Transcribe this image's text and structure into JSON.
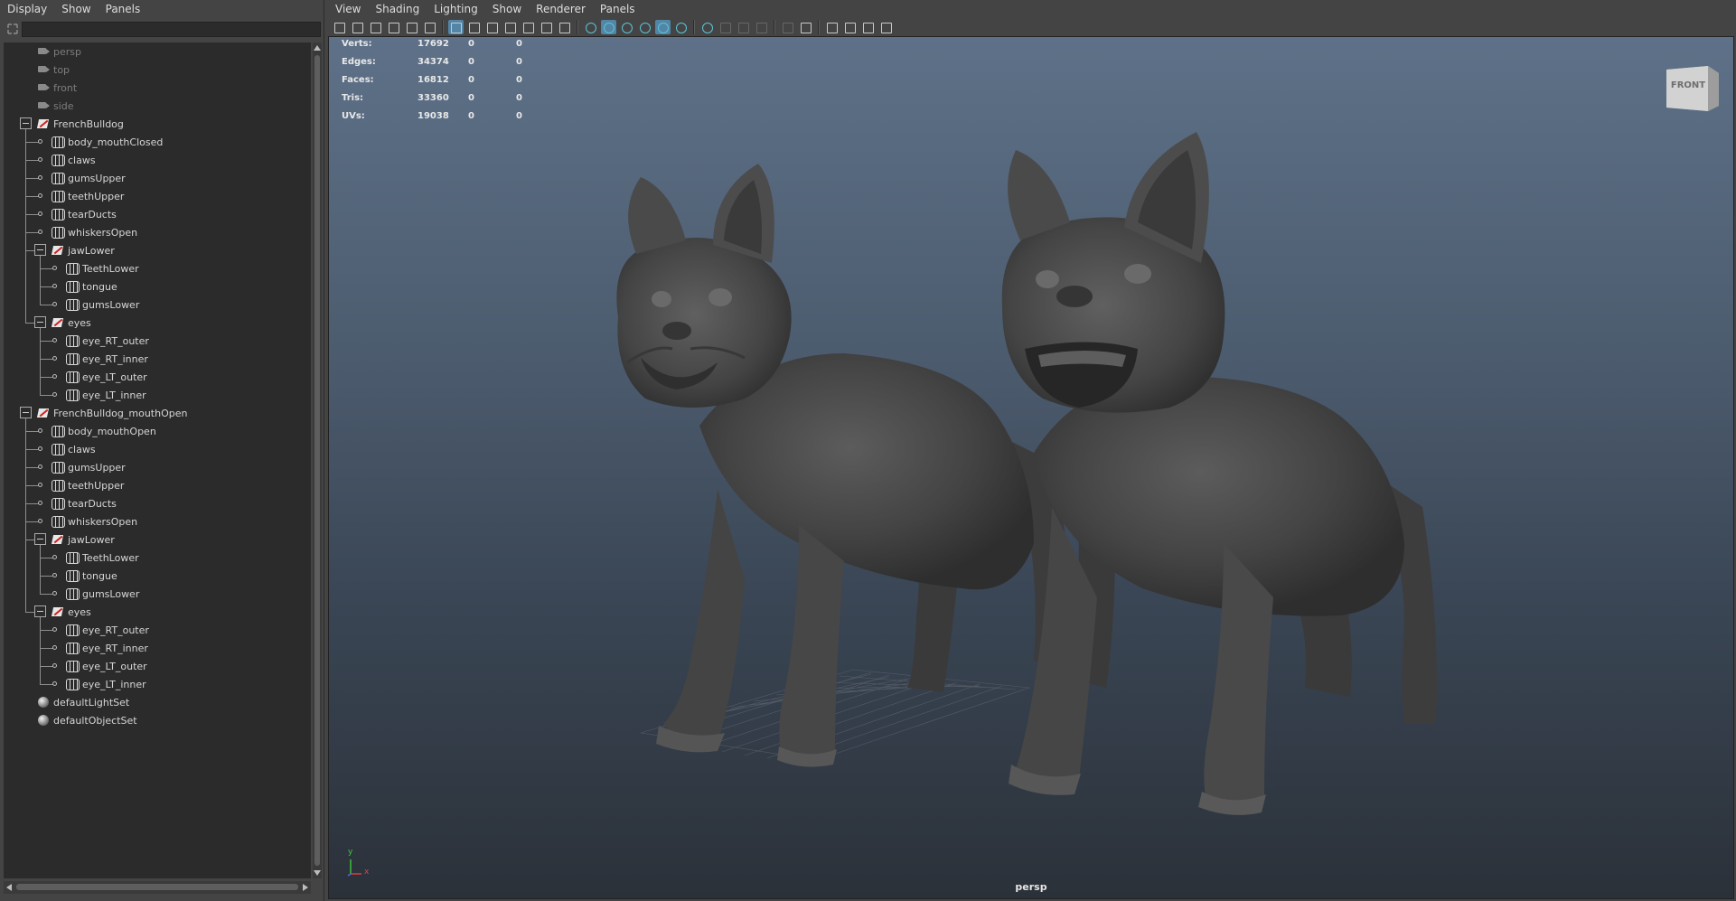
{
  "outliner": {
    "menu": [
      "Display",
      "Show",
      "Panels"
    ],
    "search_value": "",
    "nodes": [
      {
        "label": "persp",
        "icon": "camera-icon",
        "dim": true
      },
      {
        "label": "top",
        "icon": "camera-icon",
        "dim": true
      },
      {
        "label": "front",
        "icon": "camera-icon",
        "dim": true
      },
      {
        "label": "side",
        "icon": "camera-icon",
        "dim": true
      },
      {
        "label": "FrenchBulldog",
        "icon": "transform-icon",
        "expanded": true
      },
      {
        "label": "body_mouthClosed",
        "icon": "mesh-icon"
      },
      {
        "label": "claws",
        "icon": "mesh-icon"
      },
      {
        "label": "gumsUpper",
        "icon": "mesh-icon"
      },
      {
        "label": "teethUpper",
        "icon": "mesh-icon"
      },
      {
        "label": "tearDucts",
        "icon": "mesh-icon"
      },
      {
        "label": "whiskersOpen",
        "icon": "mesh-icon"
      },
      {
        "label": "jawLower",
        "icon": "transform-icon",
        "expanded": true
      },
      {
        "label": "TeethLower",
        "icon": "mesh-icon"
      },
      {
        "label": "tongue",
        "icon": "mesh-icon"
      },
      {
        "label": "gumsLower",
        "icon": "mesh-icon"
      },
      {
        "label": "eyes",
        "icon": "transform-icon",
        "expanded": true
      },
      {
        "label": "eye_RT_outer",
        "icon": "mesh-icon"
      },
      {
        "label": "eye_RT_inner",
        "icon": "mesh-icon"
      },
      {
        "label": "eye_LT_outer",
        "icon": "mesh-icon"
      },
      {
        "label": "eye_LT_inner",
        "icon": "mesh-icon"
      },
      {
        "label": "FrenchBulldog_mouthOpen",
        "icon": "transform-icon",
        "expanded": true
      },
      {
        "label": "body_mouthOpen",
        "icon": "mesh-icon"
      },
      {
        "label": "claws",
        "icon": "mesh-icon"
      },
      {
        "label": "gumsUpper",
        "icon": "mesh-icon"
      },
      {
        "label": "teethUpper",
        "icon": "mesh-icon"
      },
      {
        "label": "tearDucts",
        "icon": "mesh-icon"
      },
      {
        "label": "whiskersOpen",
        "icon": "mesh-icon"
      },
      {
        "label": "jawLower",
        "icon": "transform-icon",
        "expanded": true
      },
      {
        "label": "TeethLower",
        "icon": "mesh-icon"
      },
      {
        "label": "tongue",
        "icon": "mesh-icon"
      },
      {
        "label": "gumsLower",
        "icon": "mesh-icon"
      },
      {
        "label": "eyes",
        "icon": "transform-icon",
        "expanded": true
      },
      {
        "label": "eye_RT_outer",
        "icon": "mesh-icon"
      },
      {
        "label": "eye_RT_inner",
        "icon": "mesh-icon"
      },
      {
        "label": "eye_LT_outer",
        "icon": "mesh-icon"
      },
      {
        "label": "eye_LT_inner",
        "icon": "mesh-icon"
      },
      {
        "label": "defaultLightSet",
        "icon": "set-icon"
      },
      {
        "label": "defaultObjectSet",
        "icon": "set-icon"
      }
    ]
  },
  "viewport": {
    "menu": [
      "View",
      "Shading",
      "Lighting",
      "Show",
      "Renderer",
      "Panels"
    ],
    "hud": [
      {
        "label": "Verts:",
        "v1": "17692",
        "v2": "0",
        "v3": "0"
      },
      {
        "label": "Edges:",
        "v1": "34374",
        "v2": "0",
        "v3": "0"
      },
      {
        "label": "Faces:",
        "v1": "16812",
        "v2": "0",
        "v3": "0"
      },
      {
        "label": "Tris:",
        "v1": "33360",
        "v2": "0",
        "v3": "0"
      },
      {
        "label": "UVs:",
        "v1": "19038",
        "v2": "0",
        "v3": "0"
      }
    ],
    "viewcube_label": "FRONT",
    "axis_y": "y",
    "axis_x": "x",
    "camera_name": "persp",
    "colors": {
      "bg_top": "#5e7188",
      "bg_bottom": "#2b3139",
      "model": "#4a4a4a",
      "selection": "#5285a6"
    }
  },
  "toolbar_icons": [
    "select-camera-icon",
    "camera-attributes-icon",
    "bookmark-icon",
    "image-plane-icon",
    "2d-pan-zoom-icon",
    "grease-pencil-icon",
    "grid-icon",
    "film-gate-icon",
    "resolution-gate-icon",
    "gate-mask-icon",
    "field-chart-icon",
    "safe-action-icon",
    "safe-title-icon",
    "wireframe-icon",
    "smooth-shade-icon",
    "wireframe-on-shaded-icon",
    "xray-icon",
    "use-default-material-icon",
    "shadows-icon",
    "screen-space-ao-icon",
    "motion-blur-icon",
    "multisample-aa-icon",
    "depth-of-field-icon",
    "hud-icon",
    "isolate-select-icon",
    "xray-active-components-icon",
    "xray-joints-icon",
    "two-sided-lighting-icon",
    "backface-culling-icon"
  ]
}
